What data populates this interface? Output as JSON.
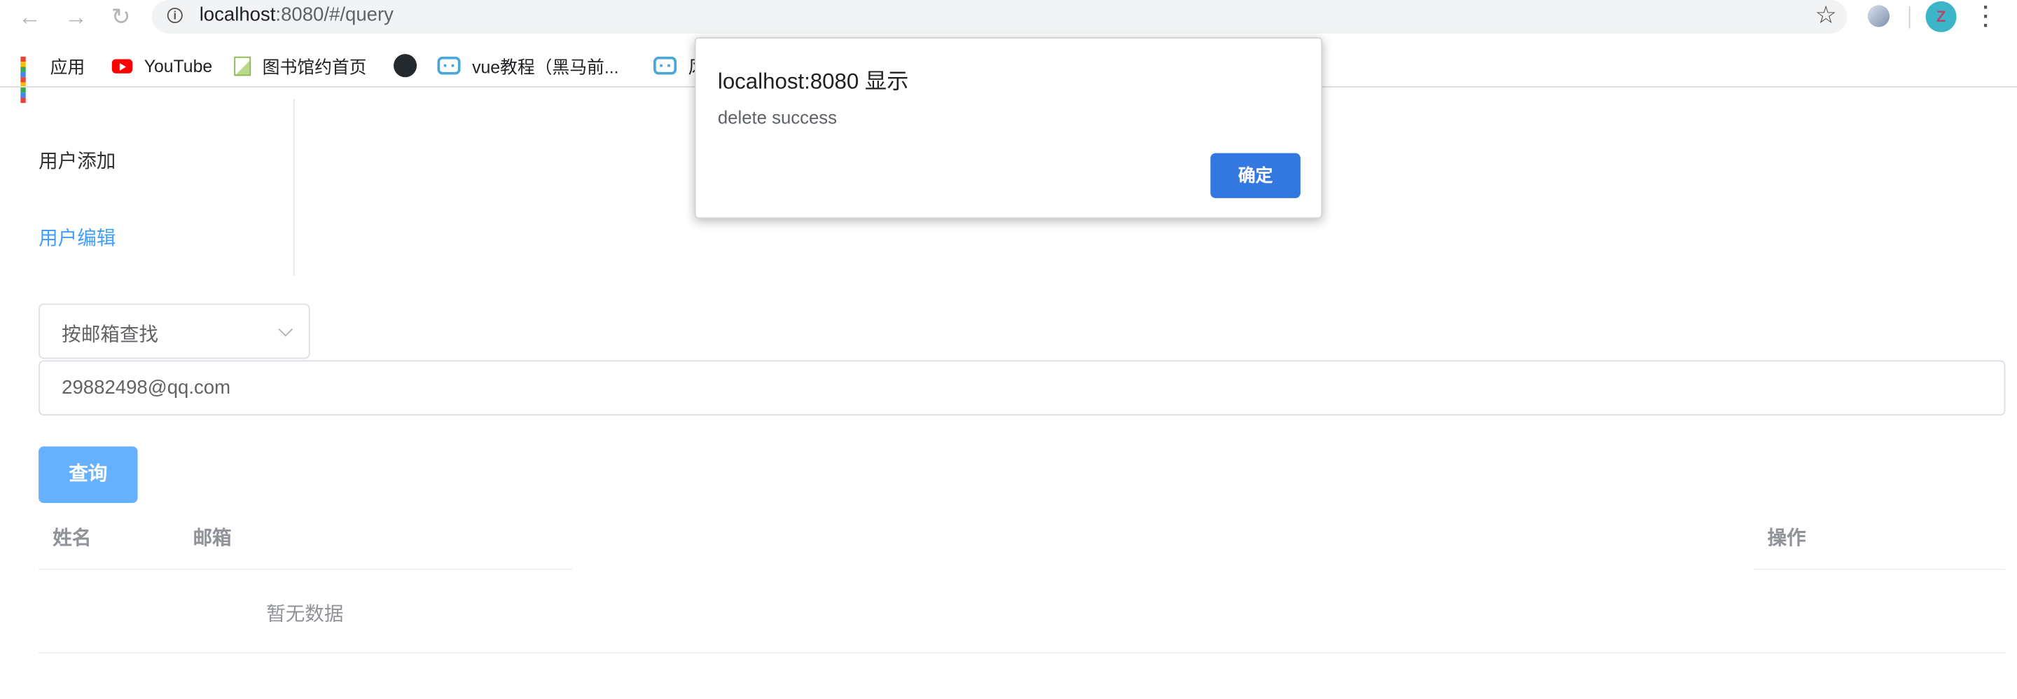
{
  "browser": {
    "url_host": "localhost",
    "url_path": ":8080/#/query",
    "bookmarks": [
      {
        "label": "应用",
        "icon": "apps-grid-icon"
      },
      {
        "label": "YouTube",
        "icon": "youtube-icon"
      },
      {
        "label": "图书馆约首页",
        "icon": "page-icon"
      },
      {
        "label": "",
        "icon": "github-icon"
      },
      {
        "label": "vue教程（黑马前...",
        "icon": "bilibili-icon"
      },
      {
        "label": "风",
        "icon": "bilibili-icon"
      }
    ],
    "avatar_letter": "Z"
  },
  "sidebar": {
    "items": [
      {
        "label": "用户添加",
        "active": false
      },
      {
        "label": "用户编辑",
        "active": true
      }
    ]
  },
  "search": {
    "select_value": "按邮箱查找",
    "input_value": "29882498@qq.com",
    "query_label": "查询"
  },
  "table": {
    "headers": [
      "姓名",
      "邮箱",
      "操作"
    ],
    "empty_text": "暂无数据"
  },
  "dialog": {
    "title": "localhost:8080 显示",
    "message": "delete success",
    "ok_label": "确定"
  },
  "colors": {
    "primary": "#409eff",
    "primary_light": "#66b1ff",
    "dialog_button": "#3377e0"
  }
}
